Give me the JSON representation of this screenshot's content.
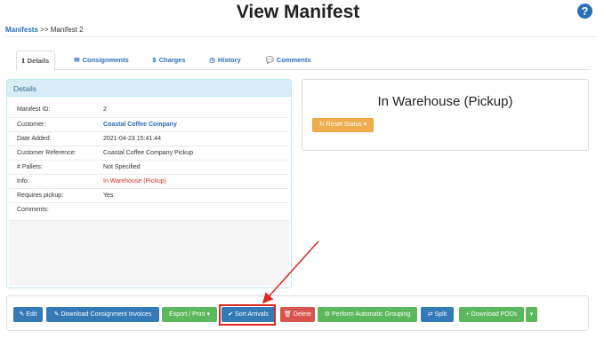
{
  "page": {
    "title": "View Manifest",
    "help_glyph": "?"
  },
  "breadcrumb": {
    "root": "Manifests",
    "separator": ">>",
    "current": "Manifest 2"
  },
  "tabs": [
    {
      "label": "Details",
      "icon": "info-icon",
      "glyph": "ℹ"
    },
    {
      "label": "Consignments",
      "icon": "envelope-icon",
      "glyph": "✉"
    },
    {
      "label": "Charges",
      "icon": "dollar-icon",
      "glyph": "$"
    },
    {
      "label": "History",
      "icon": "clock-icon",
      "glyph": "◷"
    },
    {
      "label": "Comments",
      "icon": "comment-icon",
      "glyph": "💬"
    }
  ],
  "details": {
    "heading": "Details",
    "rows": [
      {
        "key": "Manifest ID:",
        "value": "2"
      },
      {
        "key": "Customer:",
        "value": "Coastal Coffee Company"
      },
      {
        "key": "Date Added:",
        "value": "2021-04-23 15:41:44"
      },
      {
        "key": "Customer Reference:",
        "value": "Coastal Coffee Company Pickup"
      },
      {
        "key": "# Pallets:",
        "value": "Not Specified"
      },
      {
        "key": "Info:",
        "value": "In Warehouse (Pickup)"
      },
      {
        "key": "Requires pickup:",
        "value": "Yes"
      },
      {
        "key": "Comments:",
        "value": ""
      }
    ]
  },
  "status": {
    "title": "In Warehouse (Pickup)",
    "reset_label": "Reset Status",
    "reset_icon": "refresh-icon"
  },
  "toolbar": {
    "edit": "Edit",
    "download_invoices": "Download Consignment Invoices",
    "export_print": "Export / Print",
    "sort_arrivals": "Sort Arrivals",
    "delete": "Delete",
    "auto_grouping": "Perform Automatic Grouping",
    "split": "Split",
    "download_pods": "Download PODs"
  },
  "colors": {
    "primary": "#337ab7",
    "success": "#5cb85c",
    "danger": "#d9534f",
    "warning": "#f0ad4e",
    "annotation": "#e0261e"
  }
}
